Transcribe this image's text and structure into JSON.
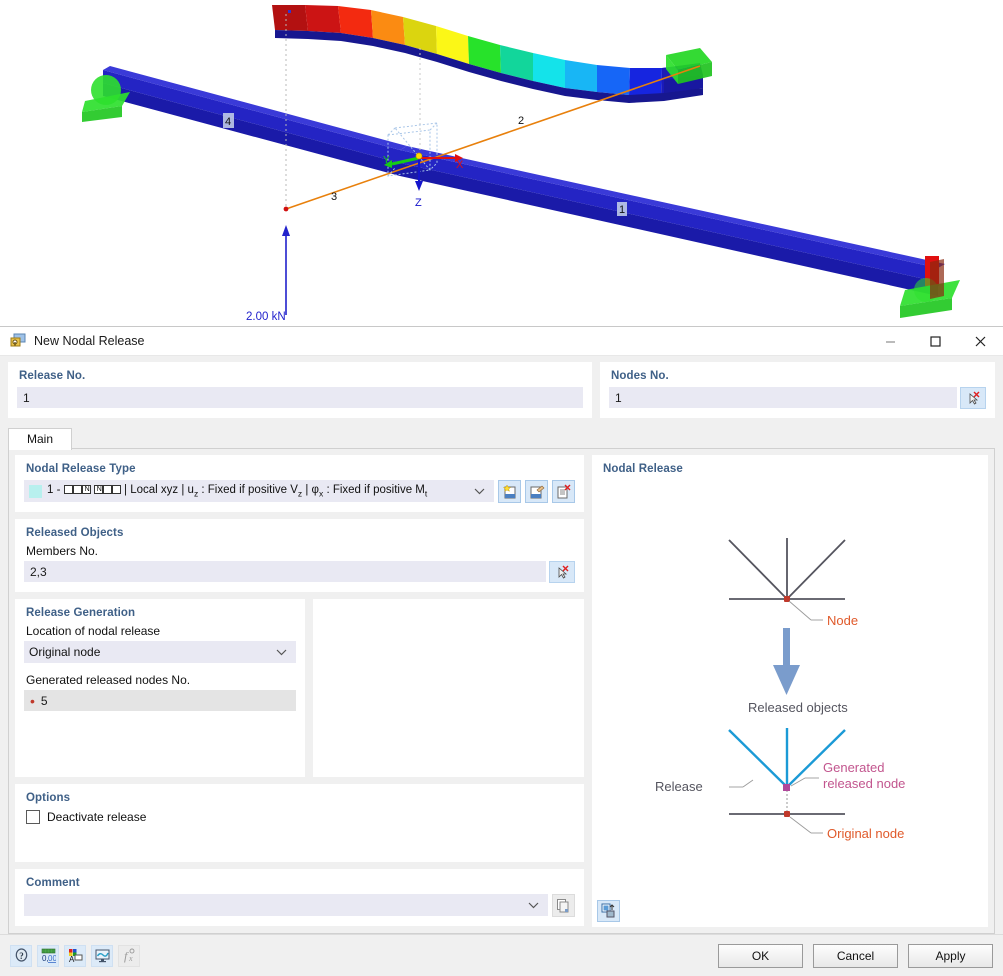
{
  "window": {
    "title": "New Nodal Release",
    "icon": "nodal-release-icon",
    "minimize": "–",
    "maximize": "□",
    "close": "✕"
  },
  "viewport": {
    "load_label": "2.00 kN",
    "member_labels": [
      "1",
      "2",
      "3",
      "4"
    ],
    "axis_x": "X",
    "axis_y": "Y",
    "axis_z": "Z"
  },
  "release_no": {
    "title": "Release No.",
    "value": "1"
  },
  "nodes_no": {
    "title": "Nodes No.",
    "value": "1",
    "pick_icon": "select-node-icon"
  },
  "tabs": [
    {
      "label": "Main",
      "active": true
    }
  ],
  "nodal_release_type": {
    "title": "Nodal Release Type",
    "value_prefix": "1 - ",
    "value_suffix": " | Local xyz | uz : Fixed if positive Vz | φx : Fixed if positive Mt",
    "swatch_color": "#b8f0ee",
    "boxes_group1": [
      "",
      "",
      "N"
    ],
    "boxes_group2": [
      "N",
      "",
      ""
    ],
    "buttons": [
      {
        "name": "new-release-type-button",
        "icon": "new-document-icon"
      },
      {
        "name": "edit-release-type-button",
        "icon": "edit-document-icon"
      },
      {
        "name": "delete-release-type-button",
        "icon": "delete-document-icon"
      }
    ]
  },
  "released_objects": {
    "title": "Released Objects",
    "members_label": "Members No.",
    "members_value": "2,3",
    "pick_icon": "select-member-icon"
  },
  "release_generation": {
    "title": "Release Generation",
    "location_label": "Location of nodal release",
    "location_value": "Original node",
    "location_options": [
      "Original node"
    ],
    "generated_label": "Generated released nodes No.",
    "generated_value": "5"
  },
  "options": {
    "title": "Options",
    "deactivate_label": "Deactivate release",
    "deactivate_checked": false
  },
  "comment": {
    "title": "Comment",
    "value": "",
    "placeholder": "",
    "copy_icon": "copy-comment-icon"
  },
  "preview": {
    "title": "Nodal Release",
    "labels": {
      "node": "Node",
      "released_objects": "Released objects",
      "release": "Release",
      "generated_released_node": "Generated released node",
      "generated_released_node_line1": "Generated",
      "generated_released_node_line2": "released node",
      "original_node": "Original node"
    },
    "colors": {
      "node_marker": "#c0392b",
      "generated_node_marker": "#b0489b",
      "release_lines": "#1b9ad6",
      "arrow": "#7a9ccc",
      "member_lines": "#55555f",
      "magenta_text": "#c2558e",
      "orange_text": "#e05a2b"
    },
    "expand_button_icon": "expand-preview-icon"
  },
  "footer": {
    "tools": [
      {
        "name": "help-tool-button",
        "icon": "question-mark-icon",
        "disabled": false
      },
      {
        "name": "units-tool-button",
        "icon": "units-number-icon",
        "disabled": false
      },
      {
        "name": "display-properties-tool-button",
        "icon": "color-palette-icon",
        "disabled": false
      },
      {
        "name": "view-tool-button",
        "icon": "monitor-icon",
        "disabled": false
      },
      {
        "name": "formula-tool-button",
        "icon": "function-icon",
        "disabled": true
      }
    ],
    "ok": "OK",
    "cancel": "Cancel",
    "apply": "Apply"
  }
}
